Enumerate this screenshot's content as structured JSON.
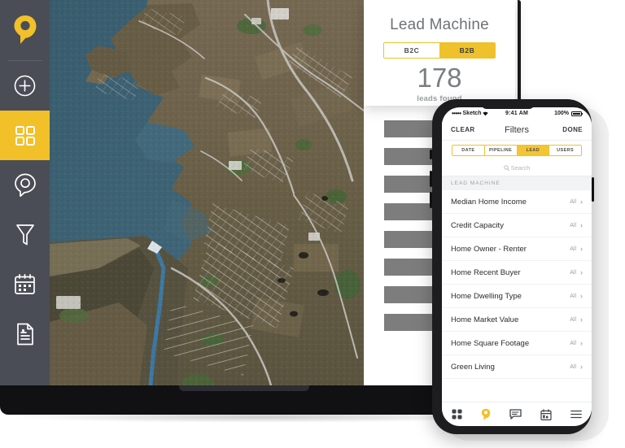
{
  "app": {
    "sidebar": {
      "logo_icon": "map-pin-logo",
      "items": [
        {
          "icon": "plus-circle-icon",
          "name": "add",
          "active": false
        },
        {
          "icon": "grid-icon",
          "name": "dashboard",
          "active": true
        },
        {
          "icon": "map-pin-icon",
          "name": "map",
          "active": false
        },
        {
          "icon": "funnel-icon",
          "name": "filter",
          "active": false
        },
        {
          "icon": "calendar-icon",
          "name": "calendar",
          "active": false
        },
        {
          "icon": "document-icon",
          "name": "reports",
          "active": false
        }
      ]
    },
    "map": {
      "label": "satellite-map"
    },
    "lead_card": {
      "title": "Lead Machine",
      "toggle": {
        "options": [
          "B2C",
          "B2B"
        ],
        "selected": "B2B"
      },
      "count": "178",
      "count_label": "leads found"
    },
    "placeholder_bars": [
      1,
      2,
      3,
      4,
      5,
      6,
      7,
      8
    ]
  },
  "phone": {
    "status": {
      "carrier": "Sketch",
      "dots": "•••••",
      "time": "9:41 AM",
      "battery": "100%"
    },
    "navbar": {
      "left": "CLEAR",
      "title": "Filters",
      "right": "DONE"
    },
    "tabs": [
      {
        "label": "DATE",
        "active": false
      },
      {
        "label": "PIPELINE",
        "active": false
      },
      {
        "label": "LEAD",
        "active": true
      },
      {
        "label": "USERS",
        "active": false
      }
    ],
    "search": {
      "placeholder": "Search",
      "icon": "search-icon"
    },
    "section_header": "LEAD MACHINE",
    "rows": [
      {
        "label": "Median Home Income",
        "value": "All"
      },
      {
        "label": "Credit Capacity",
        "value": "All"
      },
      {
        "label": "Home Owner - Renter",
        "value": "All"
      },
      {
        "label": "Home Recent Buyer",
        "value": "All"
      },
      {
        "label": "Home Dwelling Type",
        "value": "All"
      },
      {
        "label": "Home Market Value",
        "value": "All"
      },
      {
        "label": "Home Square Footage",
        "value": "All"
      },
      {
        "label": "Green Living",
        "value": "All"
      }
    ],
    "tabbar": [
      {
        "icon": "grid-icon",
        "name": "dashboard",
        "active": false
      },
      {
        "icon": "map-pin-icon",
        "name": "map",
        "active": true
      },
      {
        "icon": "chat-icon",
        "name": "messages",
        "active": false
      },
      {
        "icon": "calendar-icon",
        "name": "calendar",
        "active": false
      },
      {
        "icon": "menu-icon",
        "name": "menu",
        "active": false
      }
    ]
  },
  "colors": {
    "brand_yellow": "#f2c029",
    "sidebar_dark": "#4a4d56",
    "placeholder_gray": "#7d7d7d"
  }
}
